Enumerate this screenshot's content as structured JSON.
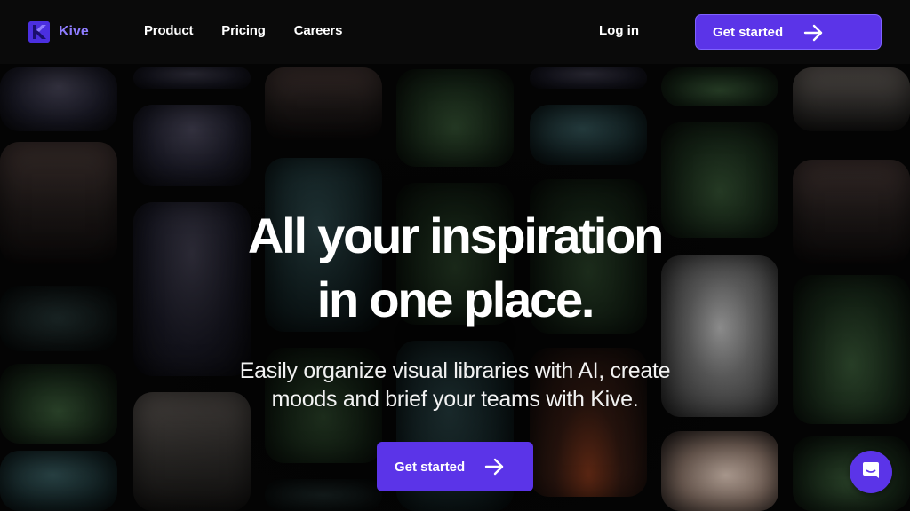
{
  "brand": {
    "name": "Kive",
    "accent": "#5b34e8",
    "logo_text_color": "#8f7dff"
  },
  "nav": {
    "items": [
      {
        "label": "Product"
      },
      {
        "label": "Pricing"
      },
      {
        "label": "Careers"
      }
    ],
    "login_label": "Log in",
    "cta_label": "Get started"
  },
  "hero": {
    "title_line1": "All your inspiration",
    "title_line2": "in one place.",
    "subtitle_line1": "Easily organize visual libraries with AI, create",
    "subtitle_line2": "moods and brief your teams with Kive.",
    "cta_label": "Get started"
  },
  "icons": {
    "arrow": "arrow-right-icon",
    "chat": "chat-icon",
    "logo": "kive-logo-icon"
  }
}
